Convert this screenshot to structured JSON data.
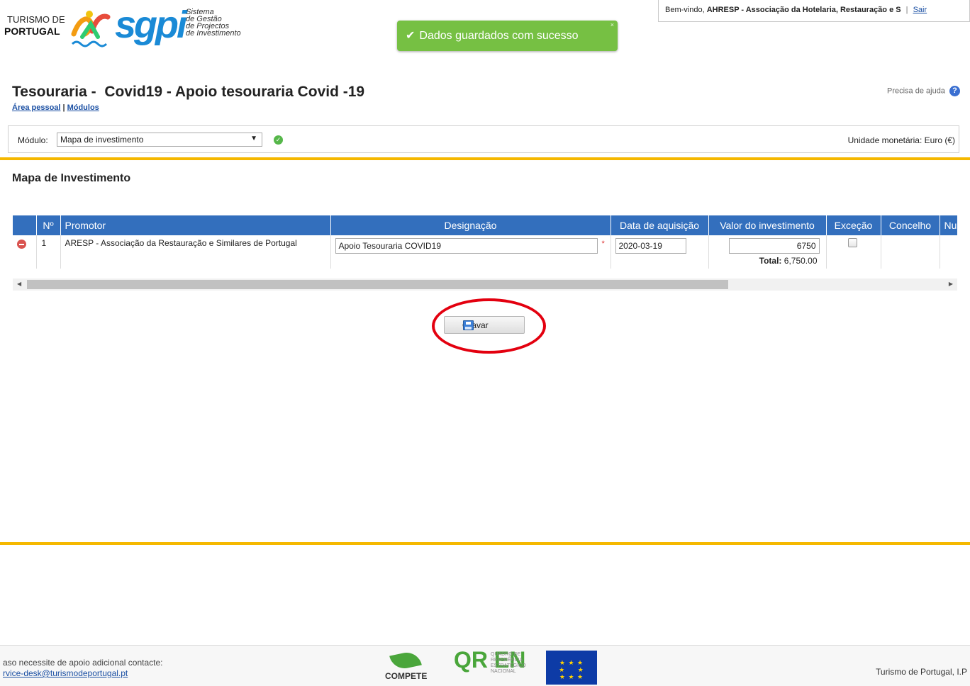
{
  "brand": {
    "tp_line1": "TURISMO DE",
    "tp_line2": "PORTUGAL",
    "sgpi": "sgpi",
    "sgpi_sub1": "Sistema",
    "sgpi_sub2": "de Gestão",
    "sgpi_sub3": "de Projectos",
    "sgpi_sub4": "de Investimento"
  },
  "user_bar": {
    "welcome": "Bem-vindo,",
    "user_name": "AHRESP - Associação da Hotelaria, Restauração e S",
    "separator": "|",
    "logout": "Sair"
  },
  "toast": {
    "message": "Dados guardados com sucesso",
    "close": "×"
  },
  "page": {
    "title": "Tesouraria -  Covid19 - Apoio tesouraria Covid -19",
    "breadcrumb_home": "Área pessoal",
    "breadcrumb_sep": "|",
    "breadcrumb_modules": "Módulos",
    "help": "Precisa de ajuda",
    "help_icon": "?"
  },
  "module_bar": {
    "label": "Módulo:",
    "selected": "Mapa de investimento",
    "currency": "Unidade monetária: Euro (€)"
  },
  "section_title": "Mapa de Investimento",
  "table": {
    "headers": [
      "Nº",
      "Promotor",
      "Designação",
      "Data de aquisição",
      "Valor do investimento",
      "Exceção",
      "Concelho",
      "Nu"
    ],
    "rows": [
      {
        "num": "1",
        "promotor": "ARESP - Associação da Restauração e Similares de Portugal",
        "designacao": "Apoio Tesouraria COVID19",
        "data": "2020-03-19",
        "valor": "6750",
        "excecao": false,
        "concelho": ""
      }
    ],
    "total_label": "Total:",
    "total_value": "6,750.00"
  },
  "save_button": "Gravar",
  "footer": {
    "support_text": "aso necessite de apoio adicional contacte:",
    "support_email": "rvice-desk@turismodeportugal.pt",
    "compete": "COMPETE",
    "qren": "QR EN",
    "qren_text": "QUADRO DE REFERÊNCIA ESTRATÉGICO NACIONAL",
    "org": "Turismo de Portugal, I.P"
  },
  "colors": {
    "accent_gold": "#f5b800",
    "table_header": "#336fbd",
    "toast_green": "#76c043",
    "highlight_red": "#e3000f"
  }
}
